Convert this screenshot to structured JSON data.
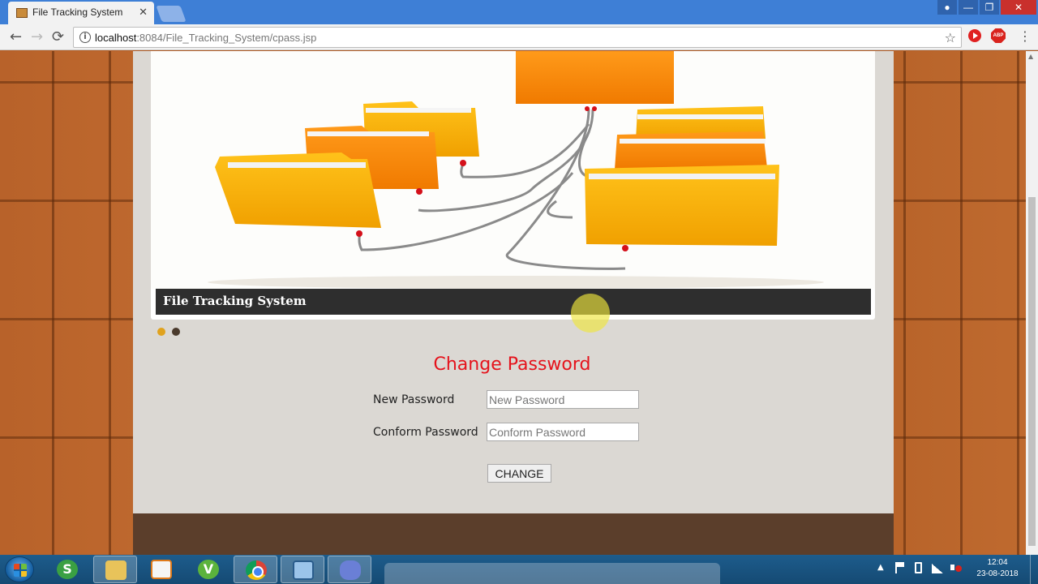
{
  "browser": {
    "tab_title": "File Tracking System",
    "tab_close": "✕",
    "url_host": "localhost",
    "url_path": ":8084/File_Tracking_System/cpass.jsp",
    "window_close": "✕",
    "window_minimize": "—",
    "window_maximize": "❐",
    "nav_back": "←",
    "nav_forward": "→",
    "nav_reload": "⟳",
    "star": "☆",
    "menu": "⋮",
    "abp": "ABP"
  },
  "slider": {
    "caption": "File Tracking System",
    "dots_count": 2,
    "active_dot": 1
  },
  "form": {
    "title": "Change Password",
    "new_password_label": "New Password",
    "new_password_placeholder": "New Password",
    "confirm_password_label": "Conform Password",
    "confirm_password_placeholder": "Conform Password",
    "submit_label": "CHANGE"
  },
  "taskbar": {
    "apps": [
      "start",
      "squirrel",
      "file-explorer",
      "media-player",
      "vlc",
      "chrome",
      "virtualbox",
      "dolphin"
    ],
    "clock_time": "12:04",
    "clock_date": "23-08-2018"
  },
  "colors": {
    "title_red": "#e5131c",
    "active_dot": "#e0a21d",
    "caption_bg": "#2e2e2e",
    "wood": "#b8622a"
  }
}
